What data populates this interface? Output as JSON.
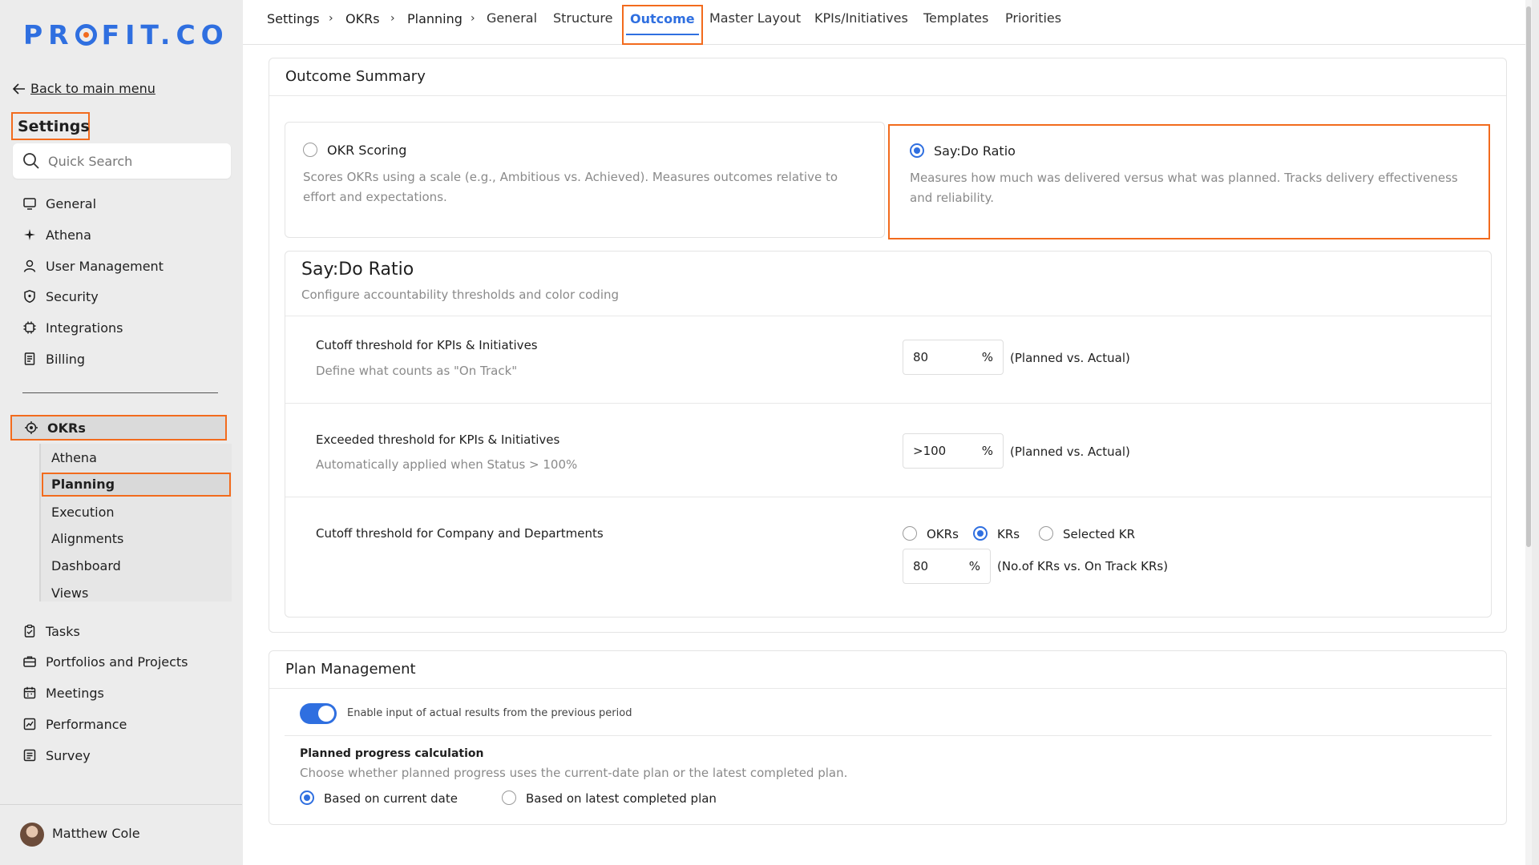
{
  "brand": {
    "logo_text_1": "PR",
    "logo_text_2": "FIT.CO"
  },
  "sidebar": {
    "back_label": "Back to main menu",
    "settings_title": "Settings",
    "search_placeholder": "Quick Search",
    "items": [
      {
        "label": "General",
        "icon": "monitor-icon"
      },
      {
        "label": "Athena",
        "icon": "sparkle-icon"
      },
      {
        "label": "User Management",
        "icon": "user-icon"
      },
      {
        "label": "Security",
        "icon": "shield-icon"
      },
      {
        "label": "Integrations",
        "icon": "chip-icon"
      },
      {
        "label": "Billing",
        "icon": "receipt-icon"
      }
    ],
    "okrs_label": "OKRs",
    "okrs_sub": [
      "Athena",
      "Planning",
      "Execution",
      "Alignments",
      "Dashboard",
      "Views"
    ],
    "items_bottom": [
      {
        "label": "Tasks",
        "icon": "clipboard-icon"
      },
      {
        "label": "Portfolios and Projects",
        "icon": "briefcase-icon"
      },
      {
        "label": "Meetings",
        "icon": "calendar-icon"
      },
      {
        "label": "Performance",
        "icon": "chart-icon"
      },
      {
        "label": "Survey",
        "icon": "list-icon"
      }
    ],
    "user_name": "Matthew Cole"
  },
  "header": {
    "breadcrumb": [
      "Settings",
      "OKRs",
      "Planning"
    ],
    "tabs": [
      "General",
      "Structure",
      "Outcome",
      "Master Layout",
      "KPIs/Initiatives",
      "Templates",
      "Priorities"
    ],
    "active_tab": "Outcome"
  },
  "outcome": {
    "title": "Outcome Summary",
    "options": [
      {
        "label": "OKR Scoring",
        "desc": "Scores OKRs using a scale (e.g., Ambitious vs. Achieved). Measures outcomes relative to effort and expectations."
      },
      {
        "label": "Say:Do Ratio",
        "desc": "Measures how much was delivered versus what was planned. Tracks delivery effectiveness and reliability."
      }
    ],
    "selected": "Say:Do Ratio"
  },
  "saydo": {
    "title": "Say:Do Ratio",
    "subtitle": "Configure accountability thresholds and color coding",
    "rows": [
      {
        "label": "Cutoff threshold for KPIs & Initiatives",
        "hint": "Define what counts as \"On Track\"",
        "value": "80",
        "unit": "%",
        "aside": "(Planned vs. Actual)"
      },
      {
        "label": "Exceeded threshold for KPIs & Initiatives",
        "hint": "Automatically applied when Status > 100%",
        "value": ">100",
        "unit": "%",
        "aside": "(Planned vs. Actual)"
      }
    ],
    "company": {
      "label": "Cutoff threshold for Company and Departments",
      "options": [
        "OKRs",
        "KRs",
        "Selected KR"
      ],
      "selected": "KRs",
      "value": "80",
      "unit": "%",
      "aside": "(No.of KRs vs. On Track KRs)"
    }
  },
  "plan": {
    "title": "Plan Management",
    "toggle_label": "Enable input of actual results from the previous period",
    "toggle_on": true,
    "progress_title": "Planned progress calculation",
    "progress_desc": "Choose whether planned progress uses the current-date plan or the latest completed plan.",
    "progress_options": [
      "Based on current date",
      "Based on latest completed plan"
    ],
    "progress_selected": "Based on current date"
  },
  "colors": {
    "accent": "#2f6fe0",
    "highlight": "#f26b1d"
  }
}
